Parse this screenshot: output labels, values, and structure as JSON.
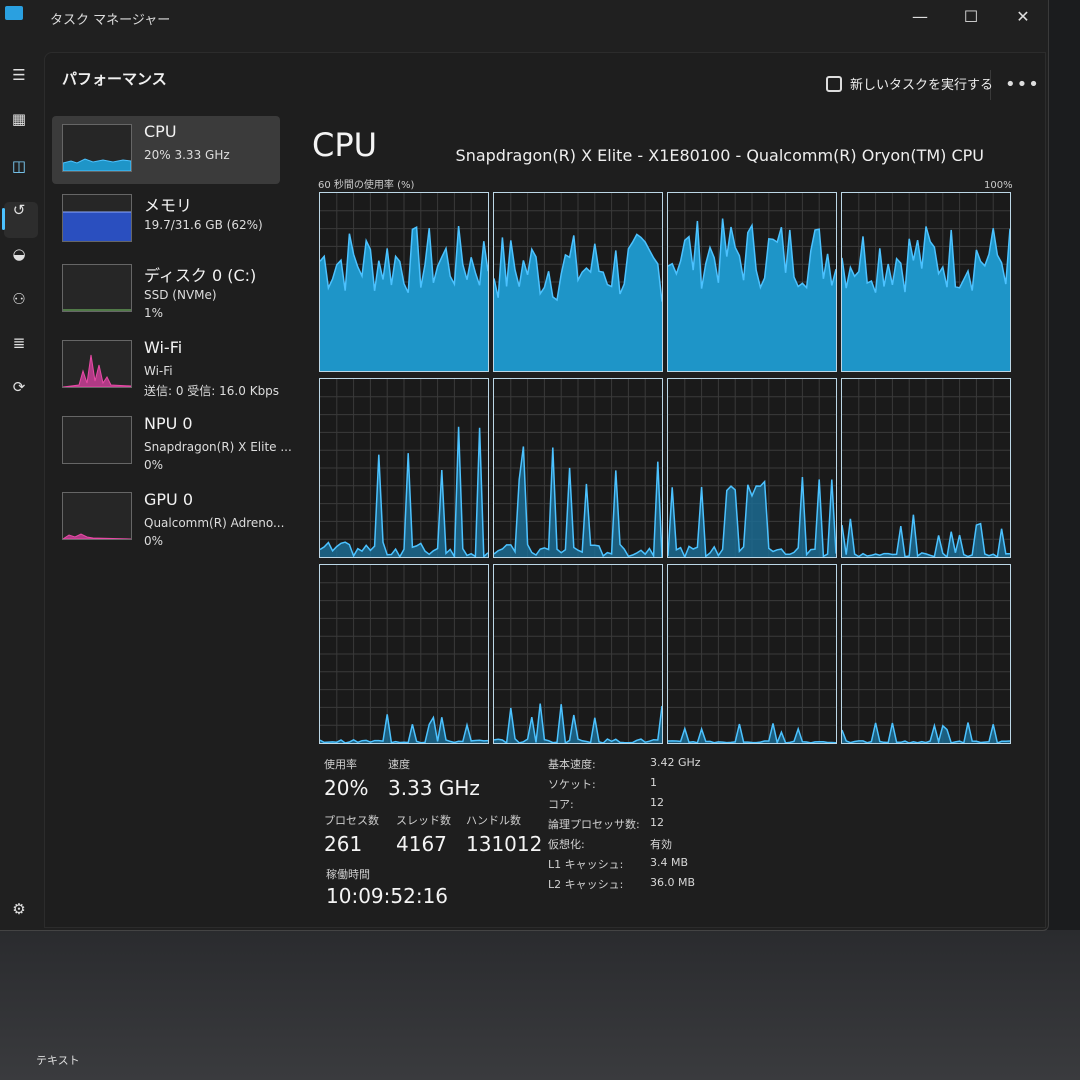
{
  "window": {
    "title": "タスク マネージャー"
  },
  "header": {
    "page_title": "パフォーマンス",
    "run_task_label": "新しいタスクを実行する",
    "more_label": "•••"
  },
  "nav": {
    "icons": [
      "menu-icon",
      "processes-icon",
      "performance-icon",
      "app-history-icon",
      "startup-icon",
      "users-icon",
      "details-icon",
      "services-icon",
      "settings-icon"
    ]
  },
  "sidebar": {
    "items": [
      {
        "title": "CPU",
        "sub1": "20%  3.33 GHz",
        "sub2": ""
      },
      {
        "title": "メモリ",
        "sub1": "19.7/31.6 GB (62%)",
        "sub2": ""
      },
      {
        "title": "ディスク 0 (C:)",
        "sub1": "SSD (NVMe)",
        "sub2": "1%"
      },
      {
        "title": "Wi-Fi",
        "sub1": "Wi-Fi",
        "sub2": "送信: 0  受信: 16.0 Kbps"
      },
      {
        "title": "NPU 0",
        "sub1": "Snapdragon(R) X Elite ...",
        "sub2": "0%"
      },
      {
        "title": "GPU 0",
        "sub1": "Qualcomm(R) Adreno...",
        "sub2": "0%"
      }
    ]
  },
  "cpu": {
    "title": "CPU",
    "model": "Snapdragon(R) X Elite - X1E80100 - Qualcomm(R) Oryon(TM) CPU",
    "graph_label": "60 秒間の使用率 (%)",
    "graph_max": "100%",
    "core_levels": [
      0.62,
      0.58,
      0.66,
      0.64,
      0.14,
      0.12,
      0.1,
      0.04,
      0.03,
      0.04,
      0.02,
      0.02
    ]
  },
  "stats": {
    "usage_label": "使用率",
    "usage_value": "20%",
    "speed_label": "速度",
    "speed_value": "3.33 GHz",
    "processes_label": "プロセス数",
    "processes_value": "261",
    "threads_label": "スレッド数",
    "threads_value": "4167",
    "handles_label": "ハンドル数",
    "handles_value": "131012",
    "uptime_label": "稼働時間",
    "uptime_value": "10:09:52:16"
  },
  "specs": [
    {
      "key": "基本速度:",
      "value": "3.42 GHz"
    },
    {
      "key": "ソケット:",
      "value": "1"
    },
    {
      "key": "コア:",
      "value": "12"
    },
    {
      "key": "論理プロセッサ数:",
      "value": "12"
    },
    {
      "key": "仮想化:",
      "value": "有効"
    },
    {
      "key": "L1 キャッシュ:",
      "value": "3.4 MB"
    },
    {
      "key": "L2 キャッシュ:",
      "value": "36.0 MB"
    }
  ],
  "taskbar": {
    "text": "テキスト"
  },
  "colors": {
    "cpu_line": "#4cc2ff",
    "cpu_fill": "#1e95c8",
    "memory_fill": "#2a4fbf",
    "wifi": "#e84aa6"
  }
}
